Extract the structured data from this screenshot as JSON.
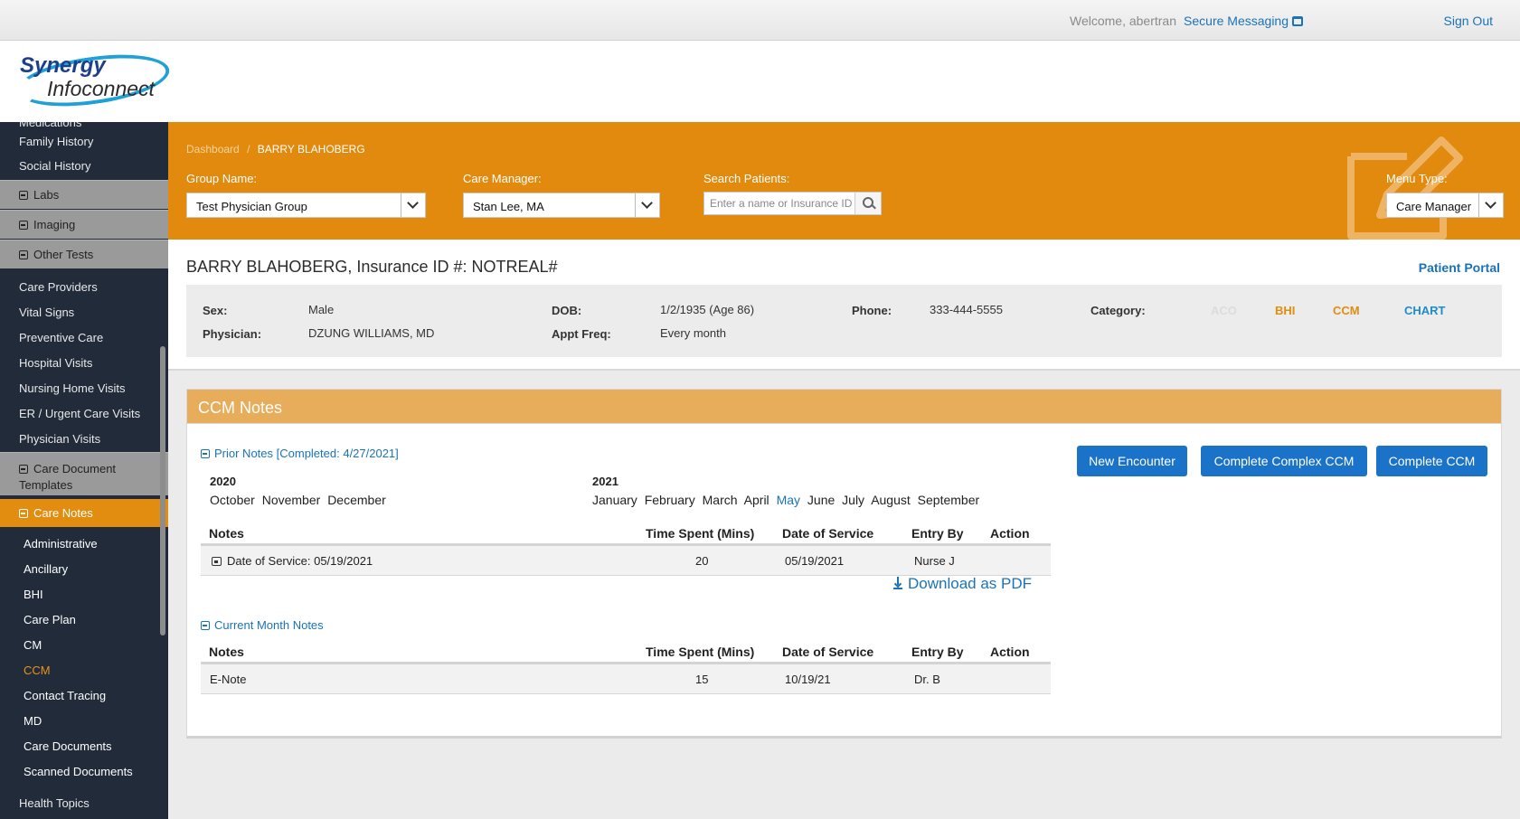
{
  "topbar": {
    "welcome": "Welcome, abertran",
    "secure_messaging": "Secure Messaging",
    "sign_out": "Sign Out"
  },
  "logo": {
    "line1": "Synergy",
    "line2": "Infoconnect"
  },
  "sidebar": {
    "items_top": [
      {
        "label": "Medications"
      },
      {
        "label": "Family History"
      },
      {
        "label": "Social History"
      }
    ],
    "sections": [
      {
        "label": "Labs"
      },
      {
        "label": "Imaging"
      },
      {
        "label": "Other Tests"
      }
    ],
    "items_mid": [
      {
        "label": "Care Providers"
      },
      {
        "label": "Vital Signs"
      },
      {
        "label": "Preventive Care"
      },
      {
        "label": "Hospital Visits"
      },
      {
        "label": "Nursing Home Visits"
      },
      {
        "label": "ER / Urgent Care Visits"
      },
      {
        "label": "Physician Visits"
      }
    ],
    "care_doc_templates": {
      "line1": "Care Document",
      "line2": "Templates"
    },
    "care_notes": "Care Notes",
    "care_notes_items": [
      {
        "label": "Administrative"
      },
      {
        "label": "Ancillary"
      },
      {
        "label": "BHI"
      },
      {
        "label": "Care Plan"
      },
      {
        "label": "CM"
      },
      {
        "label": "CCM"
      },
      {
        "label": "Contact Tracing"
      },
      {
        "label": "MD"
      },
      {
        "label": "Care Documents"
      },
      {
        "label": "Scanned Documents"
      }
    ],
    "selected_item": "CCM",
    "health_topics": "Health Topics"
  },
  "header": {
    "breadcrumb": {
      "home": "Dashboard",
      "sep": "/",
      "current": "BARRY BLAHOBERG"
    },
    "group_name": {
      "label": "Group Name:",
      "value": "Test Physician Group"
    },
    "care_manager": {
      "label": "Care Manager:",
      "value": "Stan Lee, MA"
    },
    "search": {
      "label": "Search Patients:",
      "placeholder": "Enter a name or Insurance ID #"
    },
    "menu_type": {
      "label": "Menu Type:",
      "value": "Care Manager"
    }
  },
  "patient": {
    "title": "BARRY BLAHOBERG, Insurance ID #: NOTREAL#",
    "portal_link": "Patient Portal",
    "sex_label": "Sex:",
    "sex": "Male",
    "physician_label": "Physician:",
    "physician": "DZUNG WILLIAMS, MD",
    "dob_label": "DOB:",
    "dob": "1/2/1935 (Age 86)",
    "appt_label": "Appt Freq:",
    "appt": "Every month",
    "phone_label": "Phone:",
    "phone": "333-444-5555",
    "category_label": "Category:",
    "categories": [
      {
        "label": "ACO",
        "color": "#dcdcdc"
      },
      {
        "label": "BHI",
        "color": "#e28c10"
      },
      {
        "label": "CCM",
        "color": "#e28c10"
      },
      {
        "label": "CHART",
        "color": "#1e8cc8"
      }
    ]
  },
  "notes_panel": {
    "title": "CCM Notes",
    "prior_notes": "Prior Notes [Completed: 4/27/2021]",
    "years": [
      {
        "year": "2020",
        "months": [
          "October",
          "November",
          "December"
        ]
      },
      {
        "year": "2021",
        "months": [
          "January",
          "February",
          "March",
          "April",
          "May",
          "June",
          "July",
          "August",
          "September"
        ]
      }
    ],
    "selected_month": "May",
    "buttons": {
      "new_encounter": "New Encounter",
      "complete_complex": "Complete Complex CCM",
      "complete": "Complete CCM"
    },
    "columns": [
      "Notes",
      "Time Spent (Mins)",
      "Date of Service",
      "Entry By",
      "Action"
    ],
    "prior_rows": [
      {
        "note": "Date of Service: 05/19/2021",
        "time": "20",
        "date": "05/19/2021",
        "entry": "Nurse J",
        "action": ""
      }
    ],
    "current_notes": "Current Month Notes",
    "download": "Download as PDF",
    "current_rows": [
      {
        "note": "E-Note",
        "time": "15",
        "date": "10/19/21",
        "entry": "Dr. B",
        "action": ""
      }
    ]
  },
  "icons": [
    "inbox-icon",
    "search-icon",
    "pencil-icon",
    "minus-box-icon",
    "calendar-icon",
    "download-icon",
    "chevron-down-icon"
  ]
}
